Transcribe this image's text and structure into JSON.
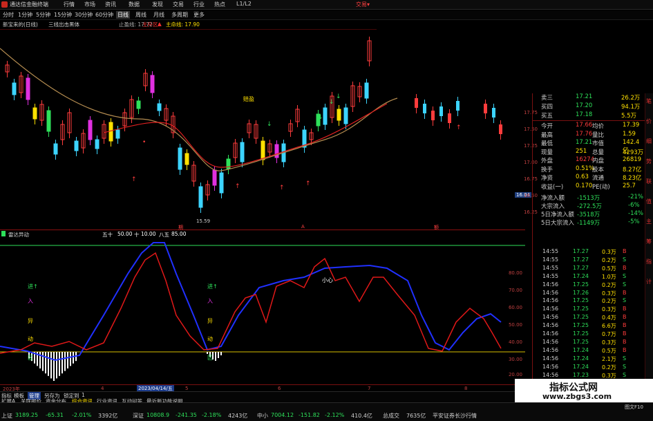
{
  "titlebar": {
    "app_title": "通达信金融终端",
    "menus": [
      "行情",
      "市场",
      "资讯",
      "数据",
      "发现",
      "交易",
      "行业",
      "热点",
      "L1/L2"
    ],
    "trade_label": "交易▾"
  },
  "periodbar": {
    "periods": [
      "分时",
      "1分钟",
      "5分钟",
      "15分钟",
      "30分钟",
      "60分钟",
      "日线",
      "周线",
      "月线",
      "多周期",
      "更多"
    ],
    "active": "日线"
  },
  "infoline": {
    "name": "新宝来的(日线)",
    "indicator": "三线出击黑体",
    "stop_label": "止盈线: 17.72",
    "main_label": "主升区:",
    "main_line_label": "主命线: 17.90",
    "main_line_arrow": "▲"
  },
  "main_chart": {
    "annotations": {
      "top": "赔盈",
      "low_price": "15.59",
      "right_price": "16.04"
    },
    "y_ticks": [
      "17.75",
      "17.50",
      "17.25",
      "17.00",
      "16.75",
      "16.50",
      "16.25"
    ],
    "bottom_marks": [
      "期",
      "A",
      "额"
    ]
  },
  "sub_chart": {
    "name": "雷达异动",
    "params": [
      "五十",
      "50.00",
      "十",
      "10.00",
      "八五",
      "85.00"
    ],
    "signal_labels": [
      "进↑",
      "入",
      "异",
      "动",
      "区"
    ],
    "annotation": "小心",
    "y_ticks": [
      "80.00",
      "70.00",
      "60.00",
      "50.00",
      "40.00",
      "30.00",
      "20.00"
    ]
  },
  "time_axis": {
    "labels": [
      "2023年",
      "4",
      "2023/04/14/五",
      "5",
      "6",
      "7",
      "8"
    ]
  },
  "quotes": {
    "order_rows": [
      {
        "label": "卖三",
        "price": "17.21",
        "vol": "26.2万"
      },
      {
        "label": "买四",
        "price": "17.20",
        "vol": "94.1万"
      },
      {
        "label": "买五",
        "price": "17.18",
        "vol": "5.5万"
      }
    ],
    "stats": [
      {
        "l1": "今开",
        "v1": "17.66",
        "l2": "均价",
        "v2": "17.39"
      },
      {
        "l1": "最高",
        "v1": "17.76",
        "l2": "量比",
        "v2": "1.59"
      },
      {
        "l1": "最低",
        "v1": "17.21",
        "l2": "市值",
        "v2": "142.4亿"
      },
      {
        "l1": "现量",
        "v1": "251",
        "l2": "总量",
        "v2": "4293万"
      },
      {
        "l1": "外盘",
        "v1": "16274",
        "l2": "内盘",
        "v2": "26819"
      },
      {
        "l1": "换手",
        "v1": "0.51%",
        "l2": "股本",
        "v2": "8.27亿"
      },
      {
        "l1": "净资",
        "v1": "0.63",
        "l2": "流通",
        "v2": "8.23亿"
      },
      {
        "l1": "收益(一)",
        "v1": "0.170",
        "l2": "PE(动)",
        "v2": "25.7"
      }
    ],
    "flows": [
      {
        "label": "净流入额",
        "value": "-1513万",
        "pct": "-21%"
      },
      {
        "label": "大宗流入",
        "value": "-272.5万",
        "pct": "-6%"
      },
      {
        "label": "5日净流入额",
        "value": "-3518万",
        "pct": "-14%"
      },
      {
        "label": "5日大宗流入",
        "value": "-1149万",
        "pct": "-5%"
      }
    ]
  },
  "ticks": [
    {
      "time": "14:55",
      "price": "17.27",
      "vol": "0.3万",
      "bs": "B"
    },
    {
      "time": "14:55",
      "price": "17.27",
      "vol": "0.2万",
      "bs": "S"
    },
    {
      "time": "14:55",
      "price": "17.27",
      "vol": "0.5万",
      "bs": "B"
    },
    {
      "time": "14:55",
      "price": "17.24",
      "vol": "1.0万",
      "bs": "S"
    },
    {
      "time": "14:56",
      "price": "17.25",
      "vol": "0.2万",
      "bs": "S"
    },
    {
      "time": "14:56",
      "price": "17.26",
      "vol": "0.3万",
      "bs": "B"
    },
    {
      "time": "14:56",
      "price": "17.25",
      "vol": "0.2万",
      "bs": "S"
    },
    {
      "time": "14:56",
      "price": "17.25",
      "vol": "0.3万",
      "bs": "B"
    },
    {
      "time": "14:56",
      "price": "17.25",
      "vol": "0.4万",
      "bs": "B"
    },
    {
      "time": "14:56",
      "price": "17.25",
      "vol": "6.6万",
      "bs": "B"
    },
    {
      "time": "14:56",
      "price": "17.25",
      "vol": "0.7万",
      "bs": "B"
    },
    {
      "time": "14:56",
      "price": "17.25",
      "vol": "0.3万",
      "bs": "B"
    },
    {
      "time": "14:56",
      "price": "17.24",
      "vol": "0.5万",
      "bs": "B"
    },
    {
      "time": "14:56",
      "price": "17.24",
      "vol": "2.1万",
      "bs": "S"
    },
    {
      "time": "14:56",
      "price": "17.24",
      "vol": "0.2万",
      "bs": "S"
    },
    {
      "time": "14:56",
      "price": "17.23",
      "vol": "0.3万",
      "bs": "S"
    },
    {
      "time": "14:56",
      "price": "17.22",
      "vol": "0.3万",
      "bs": "S"
    }
  ],
  "right_edge_tabs": [
    "笔",
    "价",
    "细",
    "势",
    "联",
    "值",
    "主",
    "筹",
    "指",
    "计"
  ],
  "button_bar": [
    "指标",
    "模板",
    "管理",
    "另存为",
    "锁定到",
    "1"
  ],
  "info_tabs": [
    "扩展A",
    "关联报价",
    "资金分布",
    "综合资讯",
    "行业资讯",
    "互动问答",
    "最近新功能说明"
  ],
  "bottom_status": {
    "index1_name": "上证",
    "index1_val": "3189.25",
    "index1_chg": "-65.31",
    "index1_pct": "-2.01%",
    "index1_amt": "3392亿",
    "index2_name": "深证",
    "index2_val": "10808.9",
    "index2_chg": "-241.35",
    "index2_pct": "-2.18%",
    "index2_amt": "4243亿",
    "index3_name": "中小",
    "index3_val": "7004.12",
    "index3_chg": "-151.82",
    "index3_pct": "-2.12%",
    "index3_amt": "410.4亿",
    "total_label": "总成交",
    "total_val": "7635亿",
    "broker": "平安证券长沙行情",
    "corner_label": "图文F10"
  },
  "watermark": {
    "line1": "指标公式网",
    "line2": "www.zbgs3.com"
  },
  "colors": {
    "up": "#ff3c3c",
    "down": "#3cd4ff",
    "yellow": "#ffe000",
    "green": "#2ee05a",
    "magenta": "#e030e0",
    "blue_line": "#2030ff",
    "red_line": "#e01818",
    "ma_brown": "#b48c50"
  }
}
